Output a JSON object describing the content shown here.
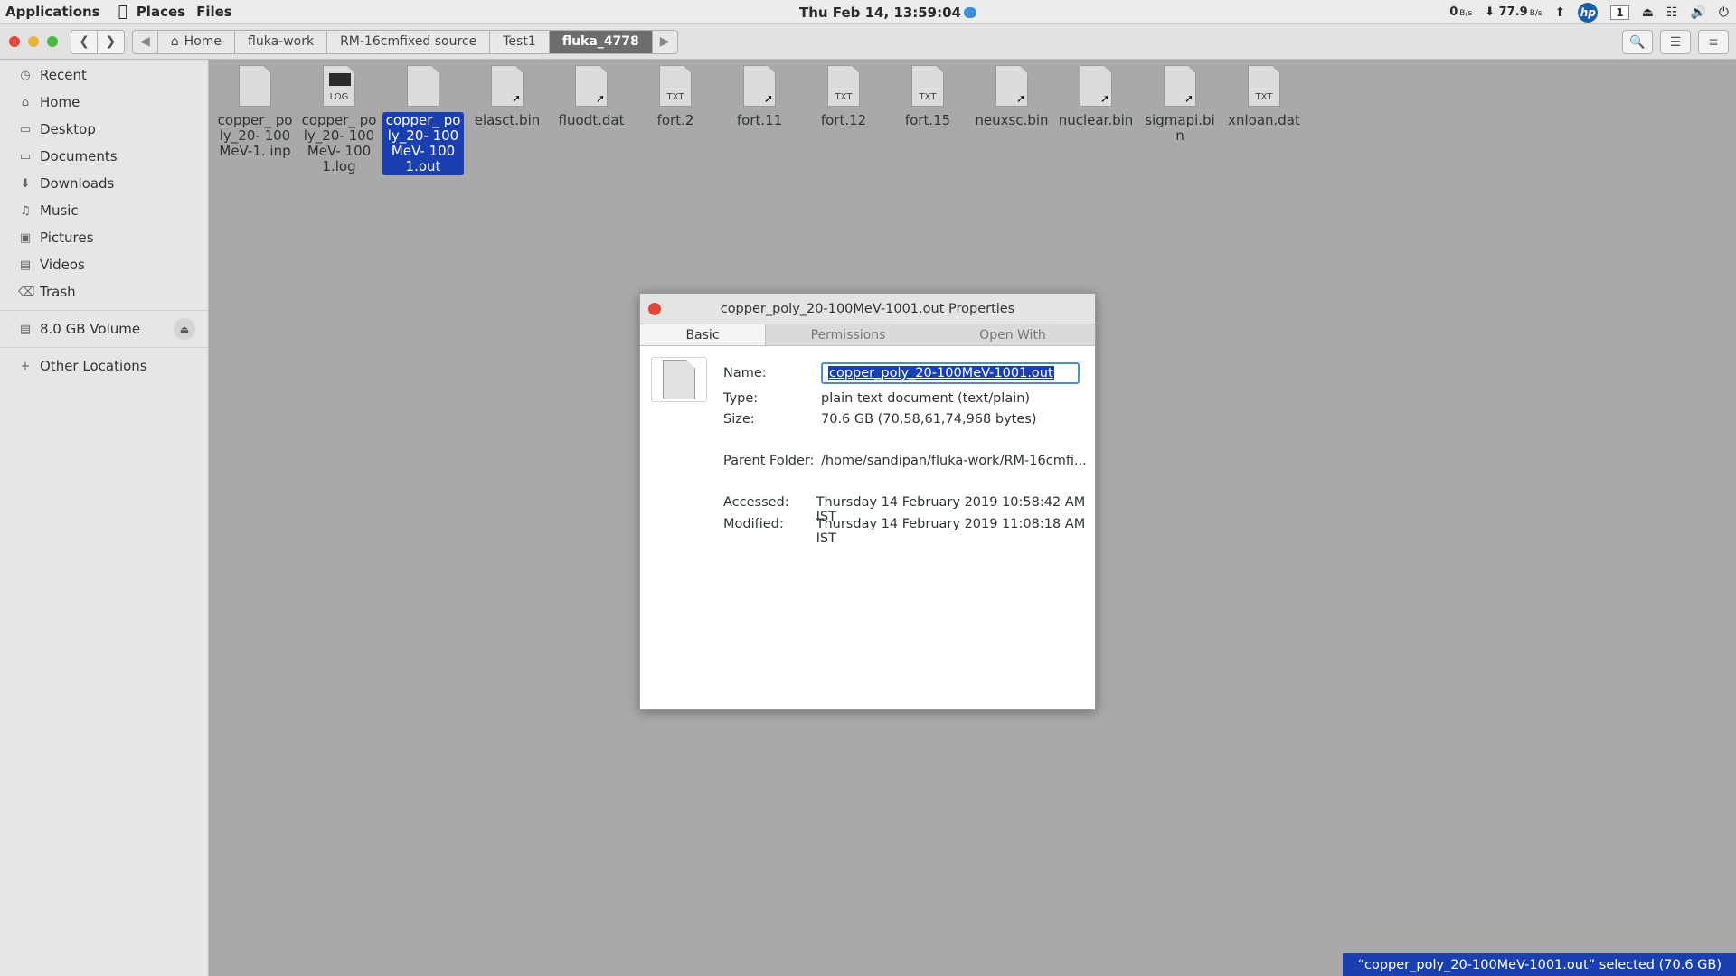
{
  "topbar": {
    "applications": "Applications",
    "places": "Places",
    "files": "Files",
    "clock": "Thu Feb 14, 13:59:04",
    "net_up": "0",
    "net_up_unit": "B/s",
    "net_down": "77.9",
    "net_down_unit": "B/s",
    "workspace": "1",
    "hp": "hp"
  },
  "nav": {
    "breadcrumbs": [
      {
        "label": "Home"
      },
      {
        "label": "fluka-work"
      },
      {
        "label": "RM-16cmfixed source"
      },
      {
        "label": "Test1"
      },
      {
        "label": "fluka_4778"
      }
    ]
  },
  "sidebar": {
    "items": [
      {
        "label": "Recent",
        "icon": "clock-icon"
      },
      {
        "label": "Home",
        "icon": "home-icon"
      },
      {
        "label": "Desktop",
        "icon": "folder-icon"
      },
      {
        "label": "Documents",
        "icon": "folder-icon"
      },
      {
        "label": "Downloads",
        "icon": "download-icon"
      },
      {
        "label": "Music",
        "icon": "music-icon"
      },
      {
        "label": "Pictures",
        "icon": "camera-icon"
      },
      {
        "label": "Videos",
        "icon": "film-icon"
      },
      {
        "label": "Trash",
        "icon": "trash-icon"
      }
    ],
    "volume": "8.0 GB Volume",
    "other": "Other Locations"
  },
  "files": [
    {
      "name": "copper_ poly_20- 100MeV-1. inp",
      "ext": "",
      "link": false
    },
    {
      "name": "copper_ poly_20- 100MeV- 1001.log",
      "ext": "LOG",
      "link": false
    },
    {
      "name": "copper_ poly_20- 100MeV- 1001.out",
      "ext": "",
      "link": false,
      "selected": true
    },
    {
      "name": "elasct.bin",
      "ext": "",
      "link": true
    },
    {
      "name": "fluodt.dat",
      "ext": "",
      "link": true
    },
    {
      "name": "fort.2",
      "ext": "TXT",
      "link": false
    },
    {
      "name": "fort.11",
      "ext": "",
      "link": true
    },
    {
      "name": "fort.12",
      "ext": "TXT",
      "link": false
    },
    {
      "name": "fort.15",
      "ext": "TXT",
      "link": false
    },
    {
      "name": "neuxsc.bin",
      "ext": "",
      "link": true
    },
    {
      "name": "nuclear.bin",
      "ext": "",
      "link": true
    },
    {
      "name": "sigmapi.bin",
      "ext": "",
      "link": true
    },
    {
      "name": "xnloan.dat",
      "ext": "TXT",
      "link": false
    }
  ],
  "dialog": {
    "title": "copper_poly_20-100MeV-1001.out Properties",
    "tabs": [
      "Basic",
      "Permissions",
      "Open With"
    ],
    "name_label": "Name:",
    "name_value": "copper_poly_20-100MeV-1001.out",
    "type_label": "Type:",
    "type_value": "plain text document (text/plain)",
    "size_label": "Size:",
    "size_value": "70.6 GB (70,58,61,74,968 bytes)",
    "parent_label": "Parent Folder:",
    "parent_value": "/home/sandipan/fluka-work/RM-16cmfi...",
    "accessed_label": "Accessed:",
    "accessed_value": "Thursday 14 February 2019 10:58:42 AM IST",
    "modified_label": "Modified:",
    "modified_value": "Thursday 14 February 2019 11:08:18 AM IST"
  },
  "status": "“copper_poly_20-100MeV-1001.out” selected (70.6 GB)"
}
